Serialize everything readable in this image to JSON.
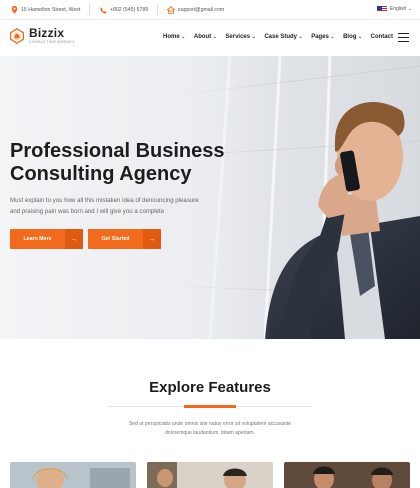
{
  "topbar": {
    "address": "15 Hamelton Street, West",
    "phone": "+802 (545) 6789",
    "email": "support@gmail.com",
    "language": "English"
  },
  "header": {
    "logo_name": "Bizzix",
    "logo_tagline": "CONSULTING AGENCY",
    "nav": [
      {
        "label": "Home",
        "dropdown": true
      },
      {
        "label": "About",
        "dropdown": true
      },
      {
        "label": "Services",
        "dropdown": true
      },
      {
        "label": "Case Study",
        "dropdown": true
      },
      {
        "label": "Pages",
        "dropdown": true
      },
      {
        "label": "Blog",
        "dropdown": true
      },
      {
        "label": "Contact",
        "dropdown": false
      }
    ]
  },
  "hero": {
    "title_line1": "Professional Business",
    "title_line2": "Consulting Agency",
    "text_line1": "Must explain to you how all this mistaken idea of denouncing pleasure",
    "text_line2": "and praising pain was born and I will give you a complete",
    "buttons": [
      {
        "label": "Learn More"
      },
      {
        "label": "Get Started"
      }
    ]
  },
  "features": {
    "title": "Explore Features",
    "text_line1": "Sed ut perspiciatis unde omnis iste natus error sit voluptatem accusante",
    "text_line2": "doloremque laudantium, totam aperiam."
  },
  "colors": {
    "accent": "#f26a1b",
    "heading": "#1b1b1b",
    "body_text": "#666666"
  },
  "icons": {
    "address": "map-pin-icon",
    "phone": "phone-icon",
    "email": "home-mail-icon",
    "menu": "hamburger-menu-icon"
  }
}
